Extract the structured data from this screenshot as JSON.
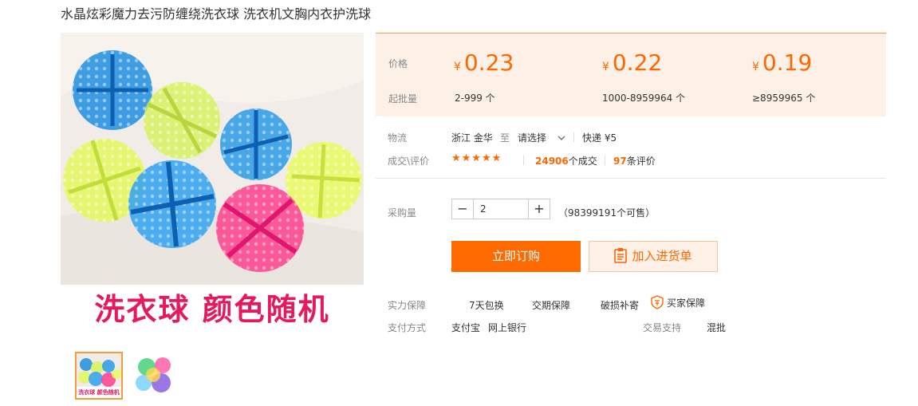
{
  "product": {
    "title": "水晶炫彩魔力去污防缠绕洗衣球 洗衣机文胸内衣护洗球",
    "banner_text": "洗衣球 颜色随机",
    "thumb_caption": "洗衣球 颜色随机"
  },
  "price": {
    "label": "价格",
    "moq_label": "起批量",
    "currency": "¥",
    "tiers": [
      {
        "price": "0.23",
        "qty": "2-999 个"
      },
      {
        "price": "0.22",
        "qty": "1000-8959964 个"
      },
      {
        "price": "0.19",
        "qty": "≥8959965 个"
      }
    ]
  },
  "logistics": {
    "label": "物流",
    "from": "浙江 金华",
    "to_word": "至",
    "select": "请选择",
    "express": "快递 ¥5"
  },
  "deals": {
    "label": "成交\\评价",
    "stars": "★★★★★",
    "count": "24906",
    "count_suffix": "个成交",
    "reviews": "97",
    "reviews_suffix": "条评价"
  },
  "purchase": {
    "label": "采购量",
    "minus": "−",
    "plus": "+",
    "quantity": "2",
    "available": "（98399191个可售）"
  },
  "actions": {
    "buy_now": "立即订购",
    "add_to_list": "加入进货单"
  },
  "guarantee": {
    "label": "实力保障",
    "items": [
      "7天包换",
      "交期保障",
      "破损补寄",
      "买家保障"
    ]
  },
  "payment": {
    "label": "支付方式",
    "methods": [
      "支付宝",
      "网上银行"
    ],
    "support_label": "交易支持",
    "support_value": "混批"
  },
  "colors": {
    "accent": "#ff6600",
    "buy_button": "#ff6a00",
    "price_bg": "#fdf1e7",
    "banner_text": "#e5195e"
  }
}
